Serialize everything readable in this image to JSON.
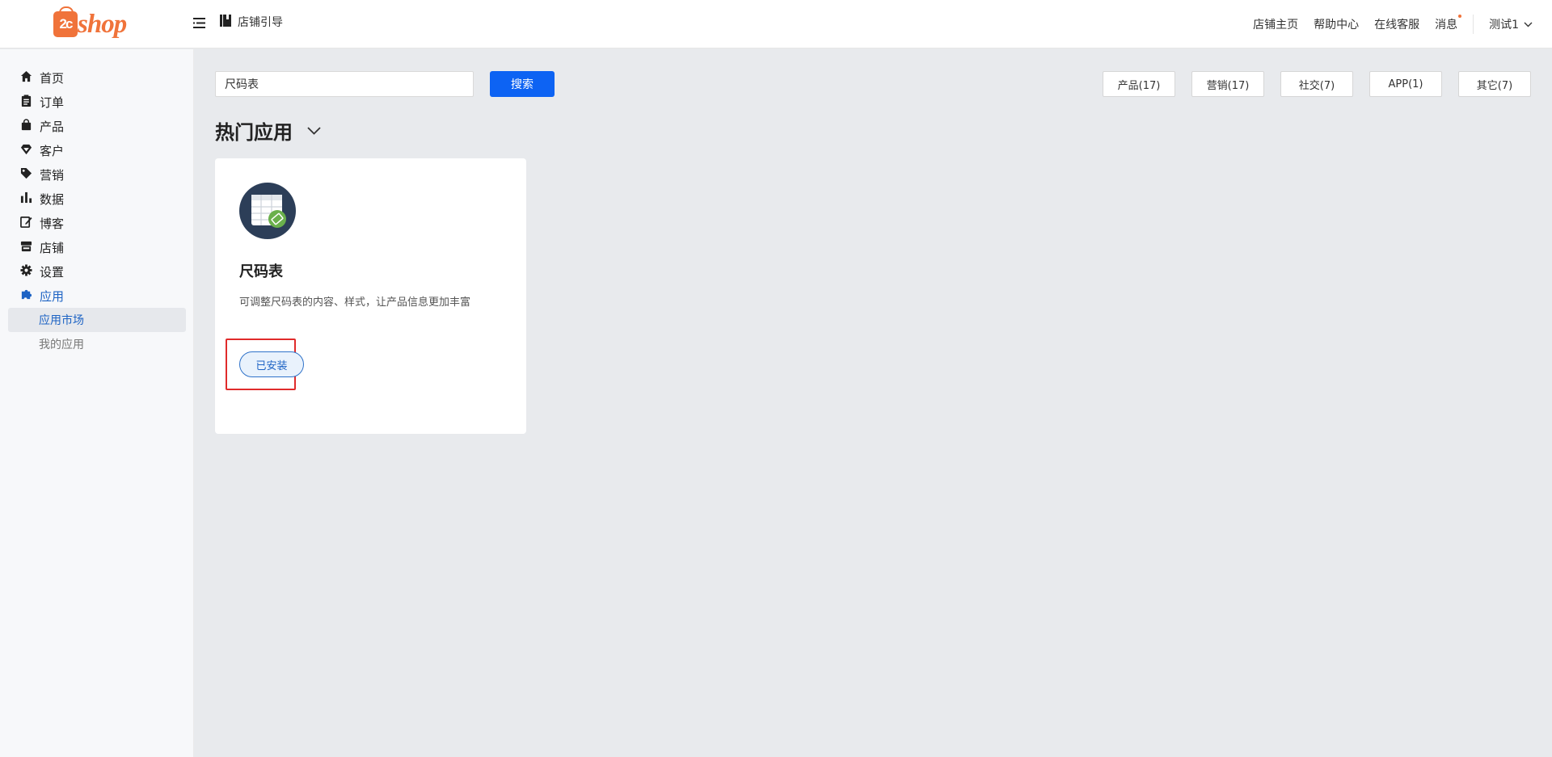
{
  "header": {
    "logo_text": "shop",
    "logo_badge": "2c",
    "guide_label": "店铺引导",
    "links": [
      "店铺主页",
      "帮助中心",
      "在线客服",
      "消息"
    ],
    "user_name": "测试1",
    "accent_color": "#f0733a"
  },
  "sidebar": {
    "items": [
      {
        "label": "首页",
        "icon": "home-icon"
      },
      {
        "label": "订单",
        "icon": "clipboard-icon"
      },
      {
        "label": "产品",
        "icon": "bag-icon"
      },
      {
        "label": "客户",
        "icon": "diamond-icon"
      },
      {
        "label": "营销",
        "icon": "tag-icon"
      },
      {
        "label": "数据",
        "icon": "bar-chart-icon"
      },
      {
        "label": "博客",
        "icon": "edit-icon"
      },
      {
        "label": "店铺",
        "icon": "store-icon"
      },
      {
        "label": "设置",
        "icon": "gear-icon"
      },
      {
        "label": "应用",
        "icon": "puzzle-icon"
      }
    ],
    "sub_items": [
      {
        "label": "应用市场"
      },
      {
        "label": "我的应用"
      }
    ],
    "active_color": "#1d63c4"
  },
  "search": {
    "value": "尺码表",
    "button_label": "搜索"
  },
  "filters": [
    "产品(17)",
    "营销(17)",
    "社交(7)",
    "APP(1)",
    "其它(7)"
  ],
  "section": {
    "title": "热门应用"
  },
  "app": {
    "name": "尺码表",
    "description": "可调整尺码表的内容、样式，让产品信息更加丰富",
    "status_label": "已安装"
  }
}
